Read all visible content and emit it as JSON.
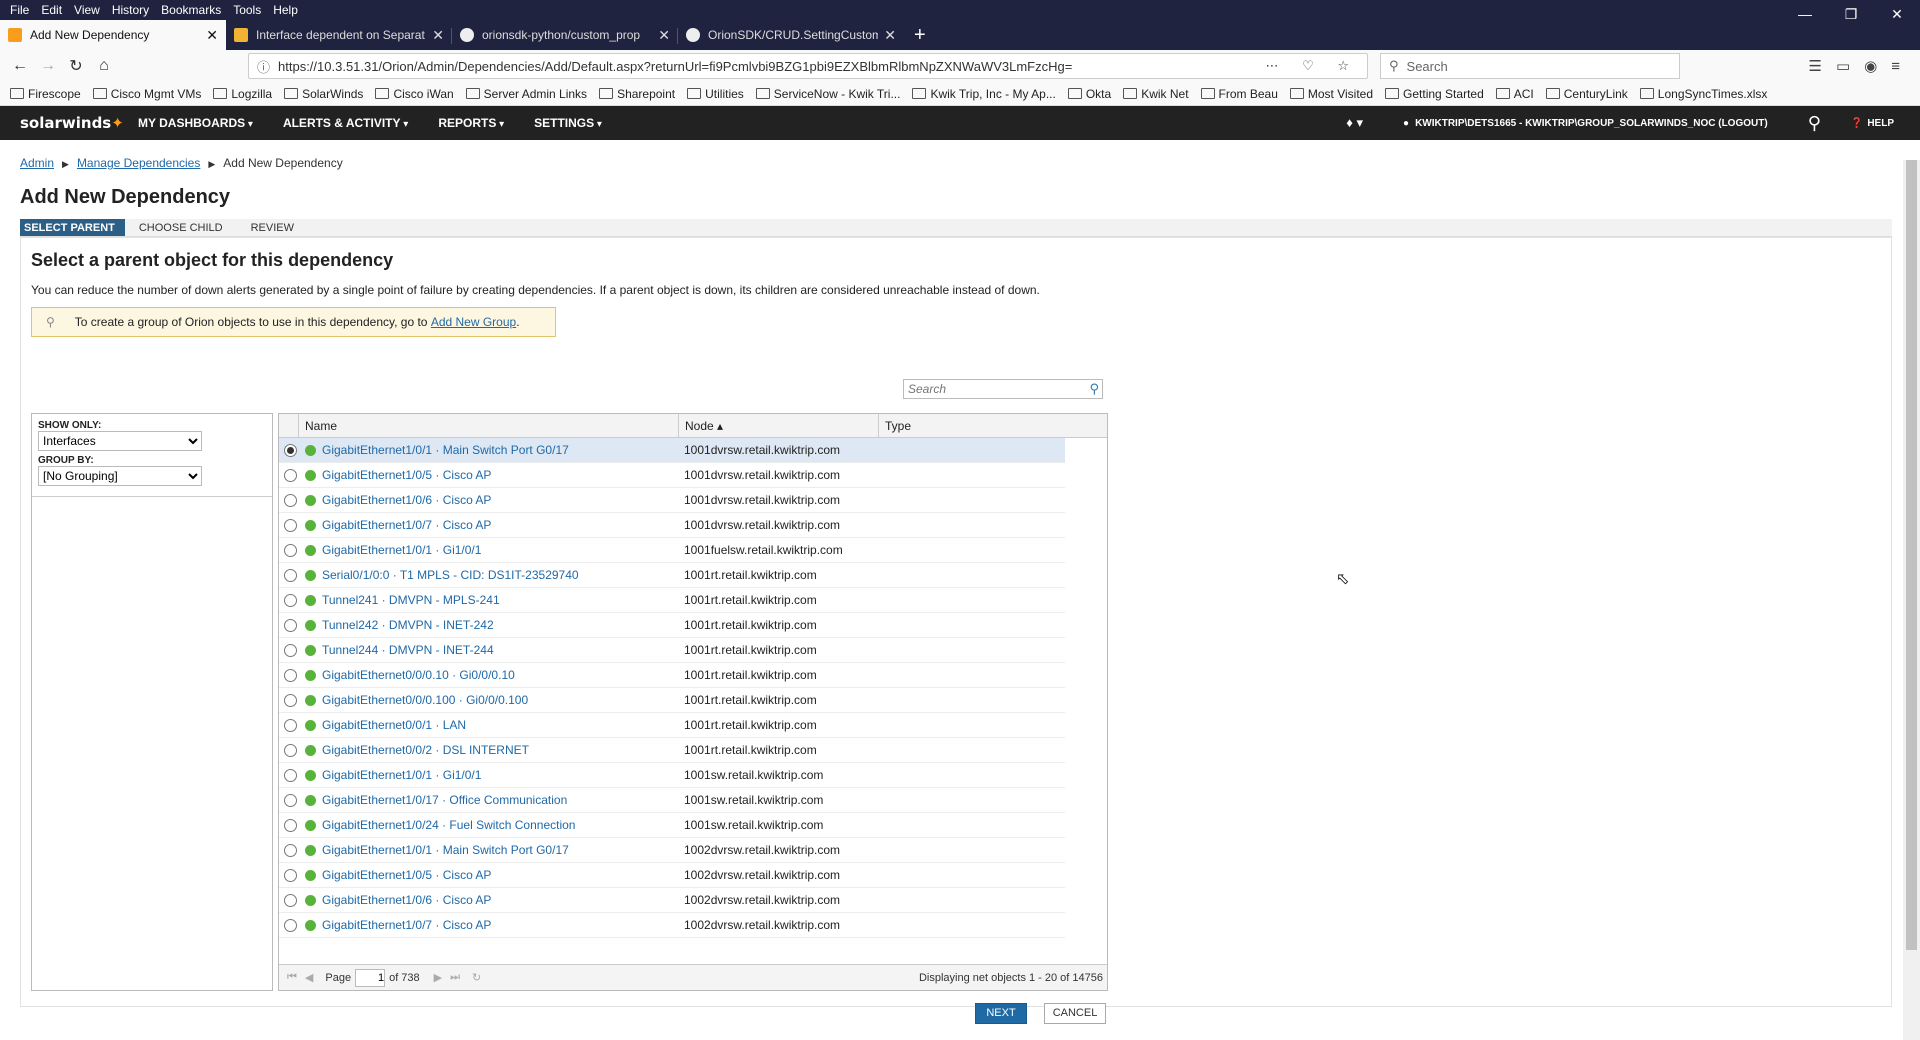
{
  "browser": {
    "menu": [
      "File",
      "Edit",
      "View",
      "History",
      "Bookmarks",
      "Tools",
      "Help"
    ],
    "tabs": [
      {
        "title": "Add New Dependency",
        "color": "#f99d1c"
      },
      {
        "title": "Interface dependent on Separat",
        "color": "#f2b233"
      },
      {
        "title": "orionsdk-python/custom_prop",
        "color": "#eeeeee"
      },
      {
        "title": "OrionSDK/CRUD.SettingCustom",
        "color": "#eeeeee"
      }
    ],
    "url": "https://10.3.51.31/Orion/Admin/Dependencies/Add/Default.aspx?returnUrl=fi9Pcmlvbi9BZG1pbi9EZXBlbmRlbmNpZXNWaWV3LmFzcHg=",
    "search_placeholder": "Search",
    "bookmarks": [
      "Firescope",
      "Cisco Mgmt VMs",
      "Logzilla",
      "SolarWinds",
      "Cisco iWan",
      "Server Admin Links",
      "Sharepoint",
      "Utilities",
      "ServiceNow - Kwik Tri...",
      "Kwik Trip, Inc - My Ap...",
      "Okta",
      "Kwik Net",
      "From Beau",
      "Most Visited",
      "Getting Started",
      "ACI",
      "CenturyLink",
      "LongSyncTimes.xlsx"
    ]
  },
  "app": {
    "logo": "solarwinds",
    "nav": [
      "MY DASHBOARDS",
      "ALERTS & ACTIVITY",
      "REPORTS",
      "SETTINGS"
    ],
    "user": "KWIKTRIP\\DETS1665 - KWIKTRIP\\GROUP_SOLARWINDS_NOC (LOGOUT)",
    "help": "HELP"
  },
  "breadcrumb": {
    "admin": "Admin",
    "manage": "Manage Dependencies",
    "current": "Add New Dependency"
  },
  "page_title": "Add New Dependency",
  "steps": [
    "SELECT PARENT",
    "CHOOSE CHILD",
    "REVIEW"
  ],
  "section_title": "Select a parent object for this dependency",
  "description": "You can reduce the number of down alerts generated by a single point of failure by creating dependencies. If a parent object is down, its children are considered unreachable instead of down.",
  "hint": {
    "text": "To create a group of Orion objects to use in this dependency, go to",
    "link": "Add New Group",
    "suffix": "."
  },
  "grid_search_placeholder": "Search",
  "filters": {
    "show_only_label": "SHOW ONLY:",
    "show_only_value": "Interfaces",
    "group_by_label": "GROUP BY:",
    "group_by_value": "[No Grouping]"
  },
  "columns": [
    "Name",
    "Node ▴",
    "Type"
  ],
  "rows": [
    {
      "name": "GigabitEthernet1/0/1 · Main Switch Port G0/17",
      "node": "1001dvrsw.retail.kwiktrip.com",
      "selected": true
    },
    {
      "name": "GigabitEthernet1/0/5 · Cisco AP",
      "node": "1001dvrsw.retail.kwiktrip.com"
    },
    {
      "name": "GigabitEthernet1/0/6 · Cisco AP",
      "node": "1001dvrsw.retail.kwiktrip.com"
    },
    {
      "name": "GigabitEthernet1/0/7 · Cisco AP",
      "node": "1001dvrsw.retail.kwiktrip.com"
    },
    {
      "name": "GigabitEthernet1/0/1 · Gi1/0/1",
      "node": "1001fuelsw.retail.kwiktrip.com"
    },
    {
      "name": "Serial0/1/0:0 · T1 MPLS - CID: DS1IT-23529740",
      "node": "1001rt.retail.kwiktrip.com"
    },
    {
      "name": "Tunnel241 · DMVPN - MPLS-241",
      "node": "1001rt.retail.kwiktrip.com"
    },
    {
      "name": "Tunnel242 · DMVPN - INET-242",
      "node": "1001rt.retail.kwiktrip.com"
    },
    {
      "name": "Tunnel244 · DMVPN - INET-244",
      "node": "1001rt.retail.kwiktrip.com"
    },
    {
      "name": "GigabitEthernet0/0/0.10 · Gi0/0/0.10",
      "node": "1001rt.retail.kwiktrip.com"
    },
    {
      "name": "GigabitEthernet0/0/0.100 · Gi0/0/0.100",
      "node": "1001rt.retail.kwiktrip.com"
    },
    {
      "name": "GigabitEthernet0/0/1 · LAN",
      "node": "1001rt.retail.kwiktrip.com"
    },
    {
      "name": "GigabitEthernet0/0/2 · DSL INTERNET",
      "node": "1001rt.retail.kwiktrip.com"
    },
    {
      "name": "GigabitEthernet1/0/1 · Gi1/0/1",
      "node": "1001sw.retail.kwiktrip.com"
    },
    {
      "name": "GigabitEthernet1/0/17 · Office Communication",
      "node": "1001sw.retail.kwiktrip.com"
    },
    {
      "name": "GigabitEthernet1/0/24 · Fuel Switch Connection",
      "node": "1001sw.retail.kwiktrip.com"
    },
    {
      "name": "GigabitEthernet1/0/1 · Main Switch Port G0/17",
      "node": "1002dvrsw.retail.kwiktrip.com"
    },
    {
      "name": "GigabitEthernet1/0/5 · Cisco AP",
      "node": "1002dvrsw.retail.kwiktrip.com"
    },
    {
      "name": "GigabitEthernet1/0/6 · Cisco AP",
      "node": "1002dvrsw.retail.kwiktrip.com"
    },
    {
      "name": "GigabitEthernet1/0/7 · Cisco AP",
      "node": "1002dvrsw.retail.kwiktrip.com"
    }
  ],
  "pager": {
    "page_label": "Page",
    "page_value": "1",
    "of_label": "of 738",
    "displaying": "Displaying net objects 1 - 20 of 14756"
  },
  "buttons": {
    "next": "NEXT",
    "cancel": "CANCEL"
  }
}
